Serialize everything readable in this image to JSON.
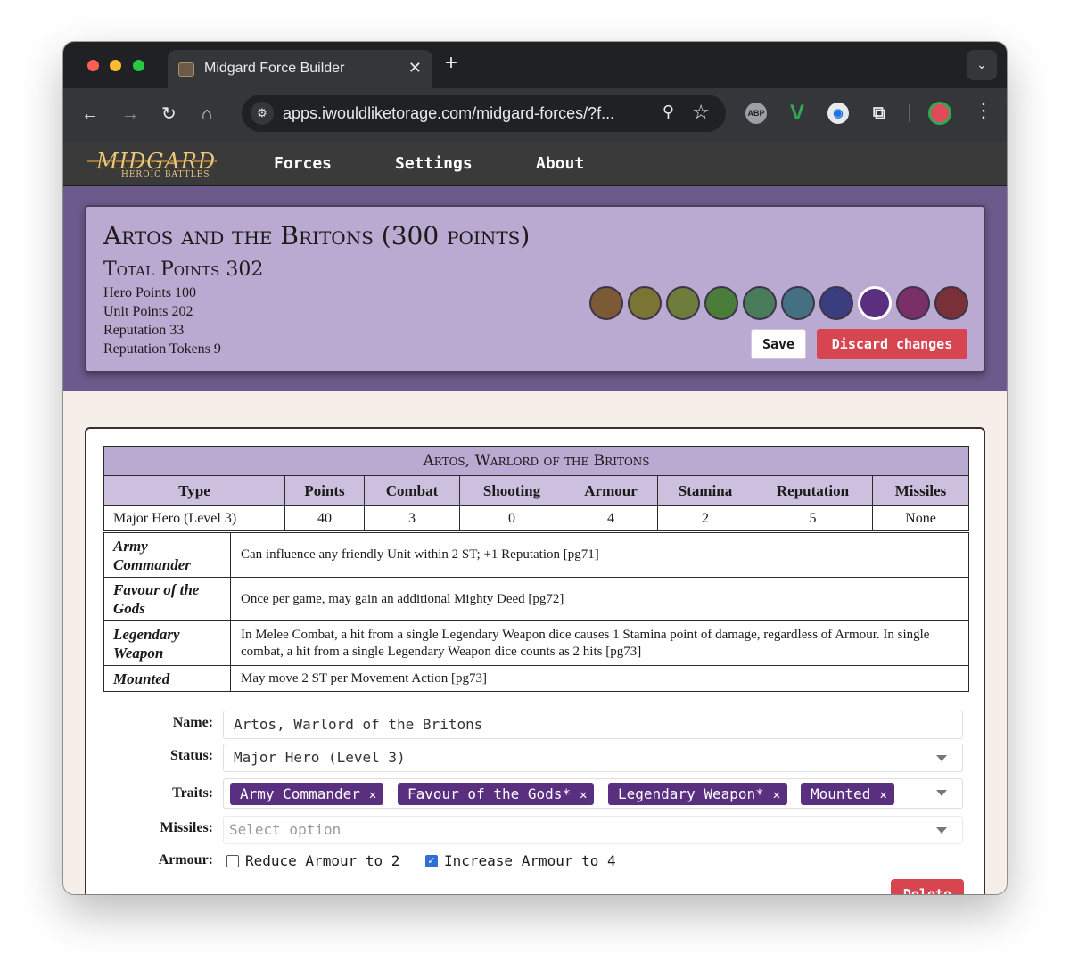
{
  "browser": {
    "tab_title": "Midgard Force Builder",
    "url": "apps.iwouldliketorage.com/midgard-forces/?f...",
    "extensions": [
      "abp",
      "v-extension",
      "lens",
      "puzzle"
    ]
  },
  "app": {
    "logo_text": "MIDGARD",
    "logo_sub": "HEROIC BATTLES",
    "nav": [
      "Forces",
      "Settings",
      "About"
    ]
  },
  "force": {
    "title": "Artos and the Britons (300 points)",
    "total_points": "Total Points 302",
    "hero_points": "Hero Points 100",
    "unit_points": "Unit Points 202",
    "reputation": "Reputation 33",
    "reputation_tokens": "Reputation Tokens 9",
    "swatches": [
      "#7b5a35",
      "#7a7535",
      "#6e7d3c",
      "#4a7c3a",
      "#4a7c5c",
      "#456f83",
      "#3b3e7e",
      "#5a2f80",
      "#7a2f68",
      "#7a3038"
    ],
    "selected_swatch_index": 7,
    "save_label": "Save",
    "discard_label": "Discard changes"
  },
  "unit": {
    "name": "Artos, Warlord of the Britons",
    "columns": [
      "Type",
      "Points",
      "Combat",
      "Shooting",
      "Armour",
      "Stamina",
      "Reputation",
      "Missiles"
    ],
    "values": [
      "Major Hero (Level 3)",
      "40",
      "3",
      "0",
      "4",
      "2",
      "5",
      "None"
    ],
    "traits": [
      {
        "name": "Army Commander",
        "desc": "Can influence any friendly Unit within 2 ST; +1 Reputation [pg71]"
      },
      {
        "name": "Favour of the Gods",
        "desc": "Once per game, may gain an additional Mighty Deed [pg72]"
      },
      {
        "name": "Legendary Weapon",
        "desc": "In Melee Combat, a hit from a single Legendary Weapon dice causes 1 Stamina point of damage, regardless of Armour. In single combat, a hit from a single Legendary Weapon dice counts as 2 hits [pg73]"
      },
      {
        "name": "Mounted",
        "desc": "May move 2 ST per Movement Action [pg73]"
      }
    ]
  },
  "form": {
    "name_label": "Name:",
    "name_value": "Artos, Warlord of the Britons",
    "status_label": "Status:",
    "status_value": "Major Hero (Level 3)",
    "traits_label": "Traits:",
    "trait_chips": [
      "Army Commander",
      "Favour of the Gods*",
      "Legendary Weapon*",
      "Mounted"
    ],
    "missiles_label": "Missiles:",
    "missiles_placeholder": "Select option",
    "armour_label": "Armour:",
    "armour_options": [
      {
        "label": "Reduce Armour to 2",
        "checked": false
      },
      {
        "label": "Increase Armour to 4",
        "checked": true
      }
    ],
    "delete_label": "Delete"
  }
}
